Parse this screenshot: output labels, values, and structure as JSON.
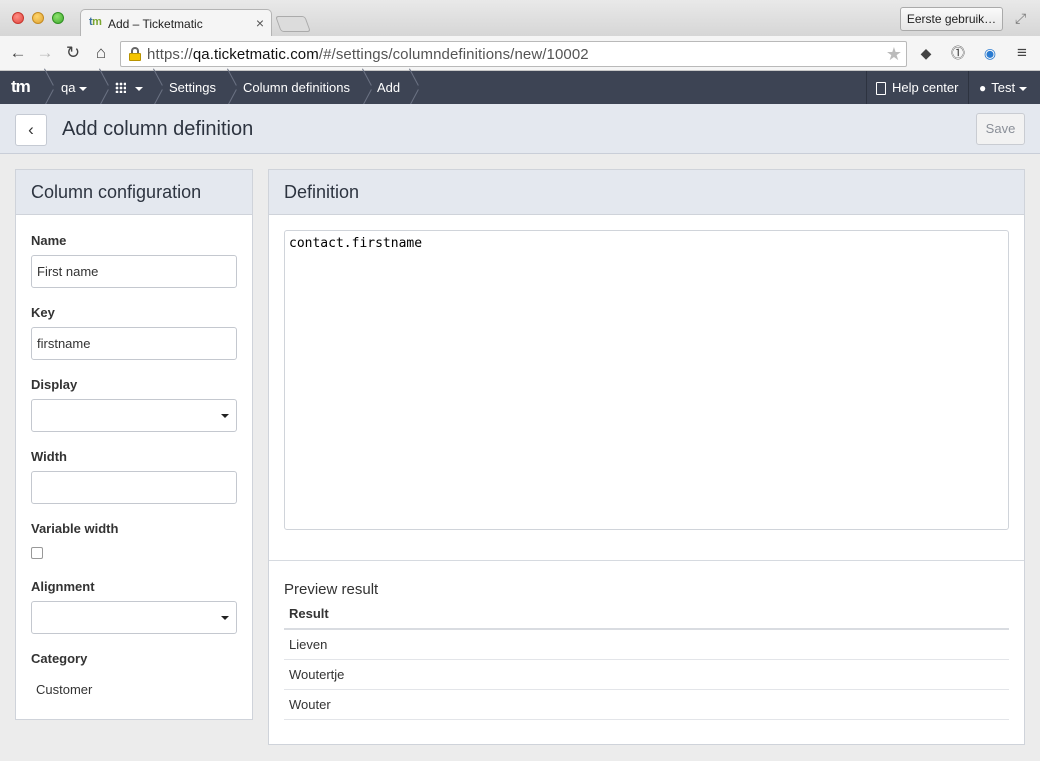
{
  "browser": {
    "tab_logo_a": "t",
    "tab_logo_b": "m",
    "tab_title": "Add – Ticketmatic",
    "tab_close": "×",
    "profile_button": "Eerste gebruik…",
    "url_prefix": "https://",
    "url_host": "qa.ticketmatic.com",
    "url_path": "/#/settings/columndefinitions/new/10002"
  },
  "appnav": {
    "brand": "tm",
    "env": "qa",
    "breadcrumbs": [
      "Settings",
      "Column definitions",
      "Add"
    ],
    "help": "Help center",
    "user": "Test"
  },
  "header": {
    "title": "Add column definition",
    "save": "Save"
  },
  "config": {
    "title": "Column configuration",
    "name_label": "Name",
    "name_value": "First name",
    "key_label": "Key",
    "key_value": "firstname",
    "display_label": "Display",
    "display_value": "",
    "width_label": "Width",
    "width_value": "",
    "variable_width_label": "Variable width",
    "variable_width_checked": false,
    "alignment_label": "Alignment",
    "alignment_value": "",
    "category_label": "Category",
    "category_value": "Customer"
  },
  "definition": {
    "title": "Definition",
    "code": "contact.firstname",
    "preview_title": "Preview result",
    "column_header": "Result",
    "rows": [
      "Lieven",
      "Woutertje",
      "Wouter"
    ]
  }
}
